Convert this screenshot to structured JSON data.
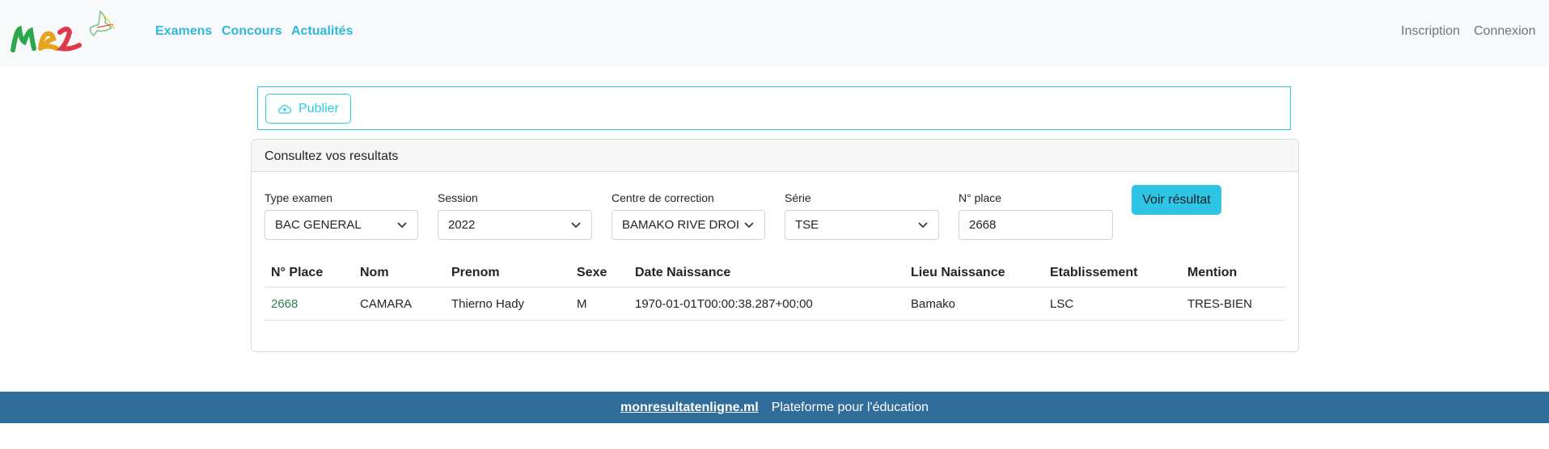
{
  "nav": {
    "links": [
      "Examens",
      "Concours",
      "Actualités"
    ],
    "right": [
      "Inscription",
      "Connexion"
    ]
  },
  "publish": {
    "label": "Publier",
    "icon": "cloud-upload-icon"
  },
  "card": {
    "header": "Consultez vos resultats",
    "filters": {
      "type_label": "Type examen",
      "type_value": "BAC GENERAL",
      "session_label": "Session",
      "session_value": "2022",
      "centre_label": "Centre de correction",
      "centre_value": "BAMAKO RIVE DROI",
      "serie_label": "Série",
      "serie_value": "TSE",
      "place_label": "N° place",
      "place_value": "2668"
    },
    "submit_label": "Voir résultat"
  },
  "table": {
    "headers": [
      "N° Place",
      "Nom",
      "Prenom",
      "Sexe",
      "Date Naissance",
      "Lieu Naissance",
      "Etablissement",
      "Mention"
    ],
    "rows": [
      [
        "2668",
        "CAMARA",
        "Thierno Hady",
        "M",
        "1970-01-01T00:00:38.287+00:00",
        "Bamako",
        "LSC",
        "TRES-BIEN"
      ]
    ]
  },
  "footer": {
    "site": "monresultatenligne.ml",
    "tagline": "Plateforme pour l'éducation"
  },
  "colors": {
    "nav_accent": "#2eb8d9",
    "outline": "#2ccbe0",
    "button": "#2ec4e6",
    "footer": "#316d9b",
    "link_green": "#2e7d4f"
  }
}
